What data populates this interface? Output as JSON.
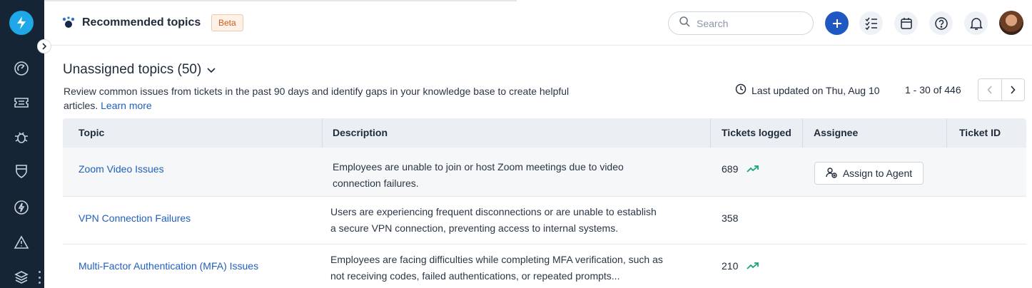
{
  "header": {
    "title": "Recommended topics",
    "badge": "Beta",
    "search_placeholder": "Search"
  },
  "section": {
    "title": "Unassigned topics (50)",
    "description": "Review common issues from tickets in the past 90 days and identify gaps in your knowledge base to create helpful articles.",
    "learn_more": "Learn more",
    "last_updated": "Last updated on Thu, Aug 10",
    "range": "1 - 30 of 446"
  },
  "table": {
    "columns": [
      "Topic",
      "Description",
      "Tickets logged",
      "Assignee",
      "Ticket ID"
    ],
    "rows": [
      {
        "topic": "Zoom Video Issues",
        "description_line1": "Employees are unable to join or host Zoom meetings due to video",
        "description_line2": "connection failures.",
        "tickets": "689",
        "trending": true,
        "assign_label": "Assign to Agent"
      },
      {
        "topic": "VPN Connection Failures",
        "description_line1": "Users are experiencing frequent disconnections or are unable to establish",
        "description_line2": "a secure VPN connection, preventing access to internal systems.",
        "tickets": "358",
        "trending": false
      },
      {
        "topic": "Multi-Factor Authentication (MFA) Issues",
        "description_line1": "Employees are facing difficulties while completing MFA verification, such as",
        "description_line2": "not receiving codes, failed authentications, or repeated prompts...",
        "tickets": "210",
        "trending": true
      }
    ]
  },
  "colors": {
    "sidebar": "#152536",
    "accent": "#1f57c3",
    "link": "#1f5fbf",
    "trend": "#1aa37a",
    "beta_text": "#d15b1e"
  },
  "sidebar_icons": [
    "lightning-logo-icon",
    "dashboard-icon",
    "ticket-icon",
    "bug-icon",
    "shield-icon",
    "bolt-icon",
    "warning-icon",
    "layers-icon"
  ]
}
